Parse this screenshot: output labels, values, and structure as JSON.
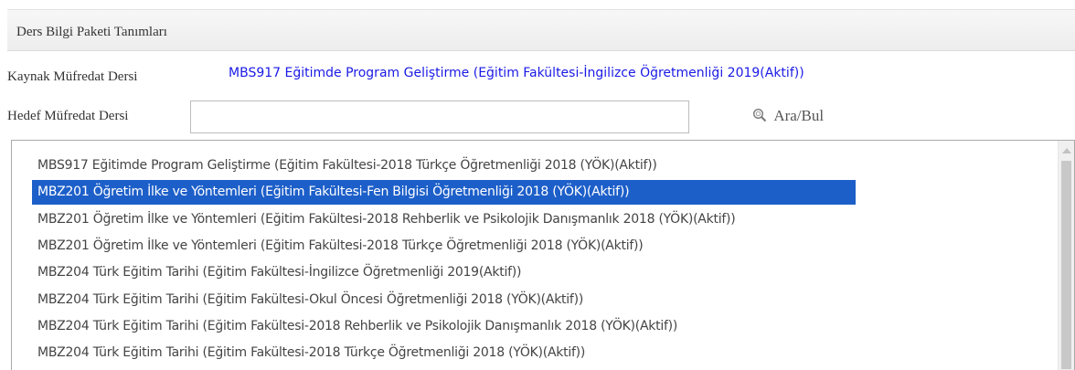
{
  "panel": {
    "title": "Ders Bilgi Paketi Tanımları"
  },
  "source": {
    "label": "Kaynak Müfredat Dersi",
    "value": "MBS917 Eğitimde Program Geliştirme (Eğitim Fakültesi-İngilizce Öğretmenliği 2019(Aktif))"
  },
  "target": {
    "label": "Hedef Müfredat Dersi",
    "value": "",
    "placeholder": ""
  },
  "search": {
    "label": "Ara/Bul",
    "icon": "magnifier-icon"
  },
  "colors": {
    "accent": "#1d5fc9",
    "source_text": "#1a1ae6"
  },
  "list": {
    "items": [
      "MBS917 Eğitimde Program Geliştirme (Eğitim Fakültesi-2018 Türkçe Öğretmenliği 2018 (YÖK)(Aktif))",
      "MBZ201 Öğretim İlke ve Yöntemleri (Eğitim Fakültesi-Fen Bilgisi Öğretmenliği 2018 (YÖK)(Aktif))",
      "MBZ201 Öğretim İlke ve Yöntemleri (Eğitim Fakültesi-2018 Rehberlik ve Psikolojik Danışmanlık 2018 (YÖK)(Aktif))",
      "MBZ201 Öğretim İlke ve Yöntemleri (Eğitim Fakültesi-2018 Türkçe Öğretmenliği 2018 (YÖK)(Aktif))",
      "MBZ204 Türk Eğitim Tarihi (Eğitim Fakültesi-İngilizce Öğretmenliği 2019(Aktif))",
      "MBZ204 Türk Eğitim Tarihi (Eğitim Fakültesi-Okul Öncesi Öğretmenliği 2018 (YÖK)(Aktif))",
      "MBZ204 Türk Eğitim Tarihi (Eğitim Fakültesi-2018 Rehberlik ve Psikolojik Danışmanlık 2018 (YÖK)(Aktif))",
      "MBZ204 Türk Eğitim Tarihi (Eğitim Fakültesi-2018 Türkçe Öğretmenliği 2018 (YÖK)(Aktif))"
    ],
    "selected_index": 1
  }
}
